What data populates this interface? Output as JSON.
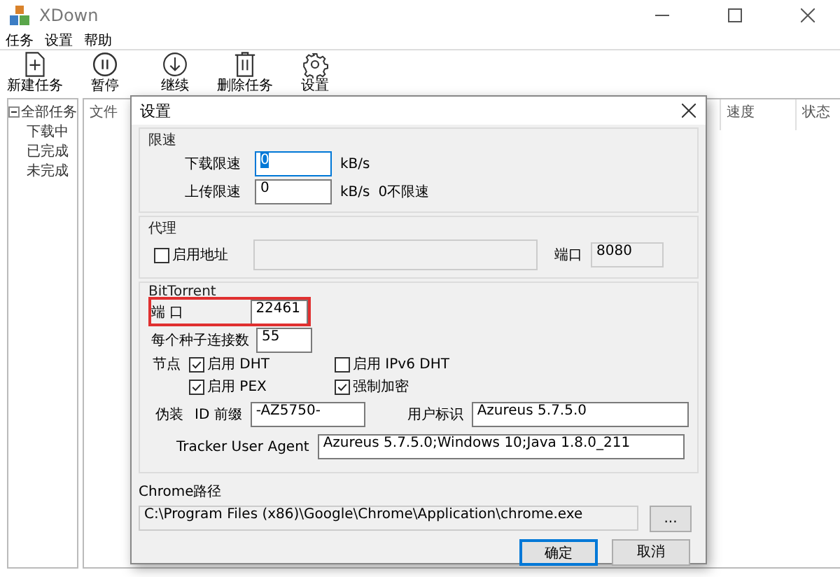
{
  "window": {
    "title": "XDown"
  },
  "menu": [
    "任务",
    "设置",
    "帮助"
  ],
  "toolbar": [
    {
      "label": "新建任务"
    },
    {
      "label": "暂停"
    },
    {
      "label": "继续"
    },
    {
      "label": "删除任务"
    },
    {
      "label": "设置"
    }
  ],
  "tree": {
    "label": "全部任务",
    "expanded": true,
    "children": [
      {
        "label": "下载中"
      },
      {
        "label": "已完成"
      },
      {
        "label": "未完成"
      }
    ]
  },
  "table": {
    "columns": [
      "文件",
      "速度",
      "状态"
    ]
  },
  "dialog": {
    "title": "设置",
    "speed_limit": {
      "title": "限速",
      "download": {
        "label": "下载限速",
        "value": "0",
        "focused": true,
        "unit": "kB/s"
      },
      "upload": {
        "label": "上传限速",
        "value": "0",
        "focused": false,
        "unit": "kB/s",
        "note": "0不限速"
      }
    },
    "proxy": {
      "title": "代理",
      "enable": {
        "label": "启用地址",
        "checked": false
      },
      "address": {
        "disabled": true
      },
      "port": {
        "label": "端口",
        "value": "8080"
      }
    },
    "bittorrent": {
      "title": "BitTorrent",
      "port": {
        "label": "端 口",
        "value": "22461",
        "highlighted": true
      },
      "connections": {
        "label": "每个种子连接数",
        "value": "55"
      },
      "nodes": {
        "label": "节点",
        "options": [
          {
            "label": "启用 DHT",
            "checked": true
          },
          {
            "label": "启用 IPv6 DHT",
            "checked": false
          },
          {
            "label": "启用 PEX",
            "checked": true
          },
          {
            "label": "强制加密",
            "checked": true
          }
        ]
      },
      "disguise": {
        "label": "伪装",
        "id_prefix": {
          "label": "ID 前缀",
          "value": "-AZ5750-"
        },
        "user_id": {
          "label": "用户标识",
          "value": "Azureus 5.7.5.0"
        },
        "tracker_user_agent": {
          "label": "Tracker User Agent",
          "value": "Azureus 5.7.5.0;Windows 10;Java 1.8.0_211"
        }
      }
    },
    "chrome": {
      "label": "Chrome路径",
      "value": "C:\\Program Files (x86)\\Google\\Chrome\\Application\\chrome.exe",
      "browse": "..."
    },
    "buttons": [
      {
        "label": "确定",
        "default": true
      },
      {
        "label": "取消",
        "default": false
      }
    ]
  }
}
